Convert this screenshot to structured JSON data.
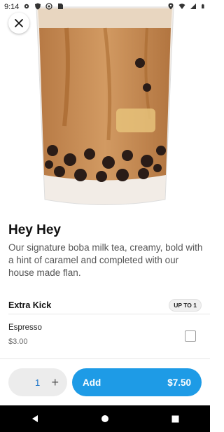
{
  "status_bar": {
    "time": "9:14",
    "icons": [
      "gear-icon",
      "shield-icon",
      "vpn-icon",
      "sd-card-icon",
      "location-icon",
      "wifi-icon",
      "signal-icon",
      "battery-icon"
    ]
  },
  "hero": {
    "image_icon": "boba-milk-tea-image",
    "close_icon": "close-icon"
  },
  "product": {
    "title": "Hey Hey",
    "description": "Our signature boba milk tea, creamy, bold with a hint of caramel and completed with our house made flan."
  },
  "options": {
    "group_label": "Extra Kick",
    "limit_badge": "UP TO 1",
    "items": [
      {
        "name": "Espresso",
        "price": "$3.00",
        "checked": false
      }
    ]
  },
  "footer": {
    "quantity": "1",
    "plus_symbol": "+",
    "add_label": "Add",
    "total": "$7.50",
    "colors": {
      "accent": "#1e9be6",
      "quantity_text": "#1a73c8"
    }
  },
  "navbar": {
    "icons": [
      "back-icon",
      "home-icon",
      "recents-icon"
    ]
  }
}
